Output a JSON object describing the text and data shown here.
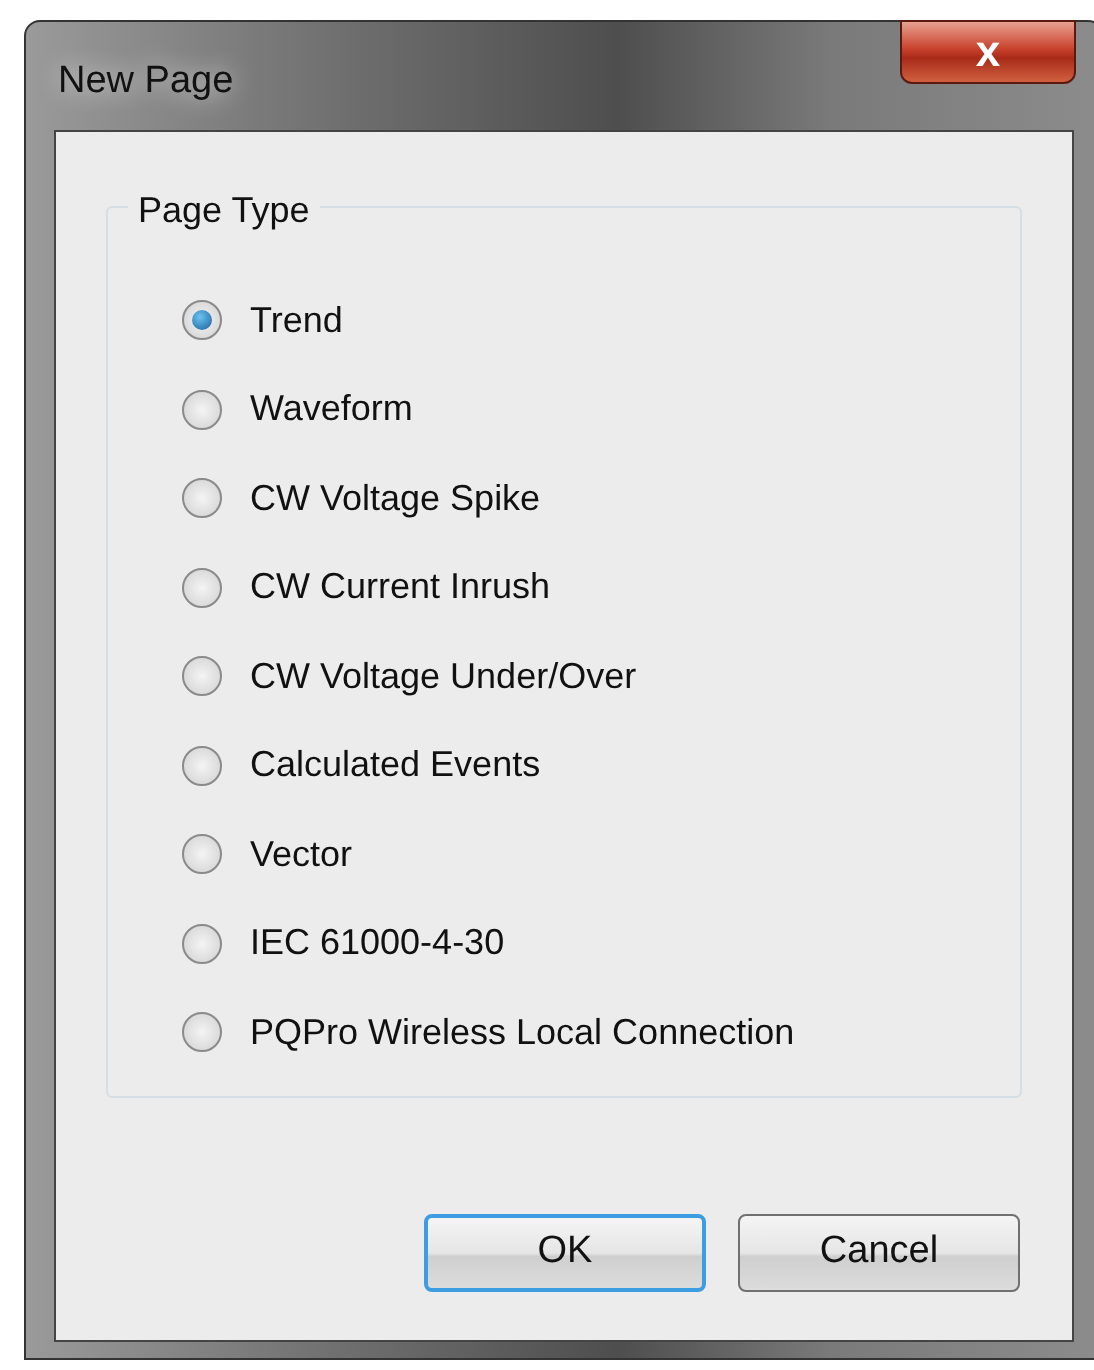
{
  "window": {
    "title": "New Page",
    "close": "x"
  },
  "group": {
    "title": "Page Type",
    "options": [
      {
        "label": "Trend",
        "selected": true
      },
      {
        "label": "Waveform",
        "selected": false
      },
      {
        "label": "CW Voltage Spike",
        "selected": false
      },
      {
        "label": "CW Current Inrush",
        "selected": false
      },
      {
        "label": "CW Voltage Under/Over",
        "selected": false
      },
      {
        "label": "Calculated Events",
        "selected": false
      },
      {
        "label": "Vector",
        "selected": false
      },
      {
        "label": "IEC 61000-4-30",
        "selected": false
      },
      {
        "label": "PQPro Wireless Local Connection",
        "selected": false
      }
    ]
  },
  "buttons": [
    {
      "label": "OK",
      "default": true
    },
    {
      "label": "Cancel",
      "default": false
    }
  ]
}
